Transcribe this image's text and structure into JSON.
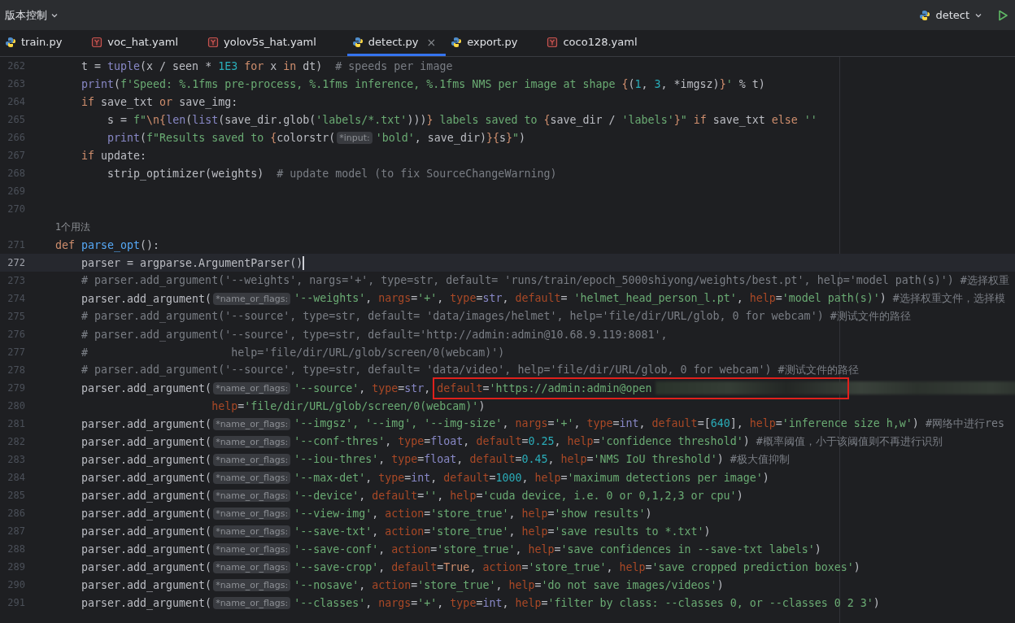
{
  "toolbar": {
    "vcs_label": "版本控制",
    "run_config": "detect"
  },
  "tabs": [
    {
      "label": "train.py",
      "kind": "python",
      "selected": false
    },
    {
      "label": "voc_hat.yaml",
      "kind": "yaml",
      "selected": false
    },
    {
      "label": "yolov5s_hat.yaml",
      "kind": "yaml",
      "selected": false
    },
    {
      "label": "detect.py",
      "kind": "python",
      "selected": true,
      "close": "×"
    },
    {
      "label": "export.py",
      "kind": "python",
      "selected": false
    },
    {
      "label": "coco128.yaml",
      "kind": "yaml",
      "selected": false
    }
  ],
  "editor": {
    "annotation": {
      "kind": "rectangle"
    },
    "lines": [
      {
        "number": "262",
        "current": false,
        "tokens": [
          {
            "kind": "plain",
            "text": "    t = "
          },
          {
            "kind": "builtin",
            "text": "tuple"
          },
          {
            "kind": "plain",
            "text": "(x / seen * "
          },
          {
            "kind": "num",
            "text": "1E3"
          },
          {
            "kind": "kw",
            "text": " for "
          },
          {
            "kind": "plain",
            "text": "x"
          },
          {
            "kind": "kw",
            "text": " in "
          },
          {
            "kind": "plain",
            "text": "dt)  "
          },
          {
            "kind": "cmt",
            "text": "# speeds per image"
          }
        ]
      },
      {
        "number": "263",
        "current": false,
        "tokens": [
          {
            "kind": "builtin",
            "text": "    print"
          },
          {
            "kind": "plain",
            "text": "("
          },
          {
            "kind": "str",
            "text": "f'Speed: %.1fms pre-process, %.1fms inference, %.1fms NMS per image at shape "
          },
          {
            "kind": "kw",
            "text": "{"
          },
          {
            "kind": "plain",
            "text": "("
          },
          {
            "kind": "num",
            "text": "1"
          },
          {
            "kind": "plain",
            "text": ", "
          },
          {
            "kind": "num",
            "text": "3"
          },
          {
            "kind": "plain",
            "text": ", *imgsz)"
          },
          {
            "kind": "kw",
            "text": "}"
          },
          {
            "kind": "str",
            "text": "'"
          },
          {
            "kind": "plain",
            "text": " % t)"
          }
        ]
      },
      {
        "number": "264",
        "current": false,
        "tokens": [
          {
            "kind": "kw",
            "text": "    if "
          },
          {
            "kind": "plain",
            "text": "save_txt "
          },
          {
            "kind": "kw",
            "text": "or "
          },
          {
            "kind": "plain",
            "text": "save_img:"
          }
        ]
      },
      {
        "number": "265",
        "current": false,
        "tokens": [
          {
            "kind": "plain",
            "text": "        s = "
          },
          {
            "kind": "str",
            "text": "f\""
          },
          {
            "kind": "kw",
            "text": "\\n{"
          },
          {
            "kind": "builtin",
            "text": "len"
          },
          {
            "kind": "plain",
            "text": "("
          },
          {
            "kind": "builtin",
            "text": "list"
          },
          {
            "kind": "plain",
            "text": "(save_dir.glob("
          },
          {
            "kind": "str",
            "text": "'labels/*.txt'"
          },
          {
            "kind": "plain",
            "text": ")))"
          },
          {
            "kind": "kw",
            "text": "}"
          },
          {
            "kind": "str",
            "text": " labels saved to "
          },
          {
            "kind": "kw",
            "text": "{"
          },
          {
            "kind": "plain",
            "text": "save_dir / "
          },
          {
            "kind": "str",
            "text": "'labels'"
          },
          {
            "kind": "kw",
            "text": "}"
          },
          {
            "kind": "str",
            "text": "\""
          },
          {
            "kind": "kw",
            "text": " if "
          },
          {
            "kind": "plain",
            "text": "save_txt "
          },
          {
            "kind": "kw",
            "text": "else "
          },
          {
            "kind": "str",
            "text": "''"
          }
        ]
      },
      {
        "number": "266",
        "current": false,
        "tokens": [
          {
            "kind": "builtin",
            "text": "        print"
          },
          {
            "kind": "plain",
            "text": "("
          },
          {
            "kind": "str",
            "text": "f\"Results saved to "
          },
          {
            "kind": "kw",
            "text": "{"
          },
          {
            "kind": "plain",
            "text": "colorstr("
          },
          {
            "kind": "hint",
            "text": "*input:"
          },
          {
            "kind": "str",
            "text": "'bold'"
          },
          {
            "kind": "plain",
            "text": ", save_dir)"
          },
          {
            "kind": "kw",
            "text": "}{"
          },
          {
            "kind": "plain",
            "text": "s"
          },
          {
            "kind": "kw",
            "text": "}"
          },
          {
            "kind": "str",
            "text": "\""
          },
          {
            "kind": "plain",
            "text": ")"
          }
        ]
      },
      {
        "number": "267",
        "current": false,
        "tokens": [
          {
            "kind": "kw",
            "text": "    if "
          },
          {
            "kind": "plain",
            "text": "update:"
          }
        ]
      },
      {
        "number": "268",
        "current": false,
        "tokens": [
          {
            "kind": "plain",
            "text": "        strip_optimizer(weights)  "
          },
          {
            "kind": "cmt",
            "text": "# update model (to fix SourceChangeWarning)"
          }
        ]
      },
      {
        "number": "269",
        "current": false
      },
      {
        "number": "270",
        "current": false
      },
      {
        "usage": "1个用法"
      },
      {
        "number": "271",
        "current": false,
        "tokens": [
          {
            "kind": "kw",
            "text": "def "
          },
          {
            "kind": "fn",
            "text": "parse_opt"
          },
          {
            "kind": "plain",
            "text": "():"
          }
        ]
      },
      {
        "number": "272",
        "current": true,
        "tokens": [
          {
            "kind": "plain",
            "text": "    parser = argparse.ArgumentParser()"
          }
        ]
      },
      {
        "number": "273",
        "current": false,
        "tokens": [
          {
            "kind": "cmt",
            "text": "    # parser.add_argument('--weights', nargs='+', type=str, default= 'runs/train/epoch_5000shiyong/weights/best.pt', help='model path(s)') #选择权重"
          }
        ]
      },
      {
        "number": "274",
        "current": false,
        "tokens": [
          {
            "kind": "plain",
            "text": "    parser.add_argument("
          },
          {
            "kind": "hint",
            "text": "*name_or_flags:"
          },
          {
            "kind": "str",
            "text": "'--weights'"
          },
          {
            "kind": "plain",
            "text": ", "
          },
          {
            "kind": "arg",
            "text": "nargs"
          },
          {
            "kind": "plain",
            "text": "="
          },
          {
            "kind": "str",
            "text": "'+'"
          },
          {
            "kind": "plain",
            "text": ", "
          },
          {
            "kind": "arg",
            "text": "type"
          },
          {
            "kind": "plain",
            "text": "="
          },
          {
            "kind": "builtin",
            "text": "str"
          },
          {
            "kind": "plain",
            "text": ", "
          },
          {
            "kind": "arg",
            "text": "default"
          },
          {
            "kind": "plain",
            "text": "= "
          },
          {
            "kind": "str",
            "text": "'helmet_head_person_l.pt'"
          },
          {
            "kind": "plain",
            "text": ", "
          },
          {
            "kind": "arg",
            "text": "help"
          },
          {
            "kind": "plain",
            "text": "="
          },
          {
            "kind": "str",
            "text": "'model path(s)'"
          },
          {
            "kind": "plain",
            "text": ") "
          },
          {
            "kind": "cmt",
            "text": "#选择权重文件，选择模"
          }
        ]
      },
      {
        "number": "275",
        "current": false,
        "tokens": [
          {
            "kind": "cmt",
            "text": "    # parser.add_argument('--source', type=str, default= 'data/images/helmet', help='file/dir/URL/glob, 0 for webcam') #测试文件的路径"
          }
        ]
      },
      {
        "number": "276",
        "current": false,
        "tokens": [
          {
            "kind": "cmt",
            "text": "    # parser.add_argument('--source', type=str, default='http://admin:admin@10.68.9.119:8081',"
          }
        ]
      },
      {
        "number": "277",
        "current": false,
        "tokens": [
          {
            "kind": "cmt",
            "text": "    #                      help='file/dir/URL/glob/screen/0(webcam)')"
          }
        ]
      },
      {
        "number": "278",
        "current": false,
        "tokens": [
          {
            "kind": "cmt",
            "text": "    # parser.add_argument('--source', type=str, default= 'data/video', help='file/dir/URL/glob, 0 for webcam') #测试文件的路径"
          }
        ]
      },
      {
        "number": "279",
        "current": false,
        "tokens": [
          {
            "kind": "plain",
            "text": "    parser.add_argument("
          },
          {
            "kind": "hint",
            "text": "*name_or_flags:"
          },
          {
            "kind": "str",
            "text": "'--source'"
          },
          {
            "kind": "plain",
            "text": ", "
          },
          {
            "kind": "arg",
            "text": "type"
          },
          {
            "kind": "plain",
            "text": "="
          },
          {
            "kind": "builtin",
            "text": "str"
          },
          {
            "kind": "plain",
            "text": ", "
          },
          {
            "kind": "arg",
            "text": "default"
          },
          {
            "kind": "plain",
            "text": "="
          },
          {
            "kind": "str",
            "text": "'https://admin:admin@open"
          },
          {
            "kind": "redacted"
          }
        ]
      },
      {
        "number": "280",
        "current": false,
        "tokens": [
          {
            "kind": "arg",
            "text": "                        help"
          },
          {
            "kind": "plain",
            "text": "="
          },
          {
            "kind": "str",
            "text": "'file/dir/URL/glob/screen/0(webcam)'"
          },
          {
            "kind": "plain",
            "text": ")"
          }
        ]
      },
      {
        "number": "281",
        "current": false,
        "tokens": [
          {
            "kind": "plain",
            "text": "    parser.add_argument("
          },
          {
            "kind": "hint",
            "text": "*name_or_flags:"
          },
          {
            "kind": "str",
            "text": "'--imgsz', '--img', '--img-size'"
          },
          {
            "kind": "plain",
            "text": ", "
          },
          {
            "kind": "arg",
            "text": "nargs"
          },
          {
            "kind": "plain",
            "text": "="
          },
          {
            "kind": "str",
            "text": "'+'"
          },
          {
            "kind": "plain",
            "text": ", "
          },
          {
            "kind": "arg",
            "text": "type"
          },
          {
            "kind": "plain",
            "text": "="
          },
          {
            "kind": "builtin",
            "text": "int"
          },
          {
            "kind": "plain",
            "text": ", "
          },
          {
            "kind": "arg",
            "text": "default"
          },
          {
            "kind": "plain",
            "text": "=["
          },
          {
            "kind": "num",
            "text": "640"
          },
          {
            "kind": "plain",
            "text": "], "
          },
          {
            "kind": "arg",
            "text": "help"
          },
          {
            "kind": "plain",
            "text": "="
          },
          {
            "kind": "str",
            "text": "'inference size h,w'"
          },
          {
            "kind": "plain",
            "text": ") "
          },
          {
            "kind": "cmt",
            "text": "#网络中进行res"
          }
        ]
      },
      {
        "number": "282",
        "current": false,
        "tokens": [
          {
            "kind": "plain",
            "text": "    parser.add_argument("
          },
          {
            "kind": "hint",
            "text": "*name_or_flags:"
          },
          {
            "kind": "str",
            "text": "'--conf-thres'"
          },
          {
            "kind": "plain",
            "text": ", "
          },
          {
            "kind": "arg",
            "text": "type"
          },
          {
            "kind": "plain",
            "text": "="
          },
          {
            "kind": "builtin",
            "text": "float"
          },
          {
            "kind": "plain",
            "text": ", "
          },
          {
            "kind": "arg",
            "text": "default"
          },
          {
            "kind": "plain",
            "text": "="
          },
          {
            "kind": "num",
            "text": "0.25"
          },
          {
            "kind": "plain",
            "text": ", "
          },
          {
            "kind": "arg",
            "text": "help"
          },
          {
            "kind": "plain",
            "text": "="
          },
          {
            "kind": "str",
            "text": "'confidence threshold'"
          },
          {
            "kind": "plain",
            "text": ") "
          },
          {
            "kind": "cmt",
            "text": "#概率阈值，小于该阈值则不再进行识别"
          }
        ]
      },
      {
        "number": "283",
        "current": false,
        "tokens": [
          {
            "kind": "plain",
            "text": "    parser.add_argument("
          },
          {
            "kind": "hint",
            "text": "*name_or_flags:"
          },
          {
            "kind": "str",
            "text": "'--iou-thres'"
          },
          {
            "kind": "plain",
            "text": ", "
          },
          {
            "kind": "arg",
            "text": "type"
          },
          {
            "kind": "plain",
            "text": "="
          },
          {
            "kind": "builtin",
            "text": "float"
          },
          {
            "kind": "plain",
            "text": ", "
          },
          {
            "kind": "arg",
            "text": "default"
          },
          {
            "kind": "plain",
            "text": "="
          },
          {
            "kind": "num",
            "text": "0.45"
          },
          {
            "kind": "plain",
            "text": ", "
          },
          {
            "kind": "arg",
            "text": "help"
          },
          {
            "kind": "plain",
            "text": "="
          },
          {
            "kind": "str",
            "text": "'NMS IoU threshold'"
          },
          {
            "kind": "plain",
            "text": ") "
          },
          {
            "kind": "cmt",
            "text": "#极大值抑制"
          }
        ]
      },
      {
        "number": "284",
        "current": false,
        "tokens": [
          {
            "kind": "plain",
            "text": "    parser.add_argument("
          },
          {
            "kind": "hint",
            "text": "*name_or_flags:"
          },
          {
            "kind": "str",
            "text": "'--max-det'"
          },
          {
            "kind": "plain",
            "text": ", "
          },
          {
            "kind": "arg",
            "text": "type"
          },
          {
            "kind": "plain",
            "text": "="
          },
          {
            "kind": "builtin",
            "text": "int"
          },
          {
            "kind": "plain",
            "text": ", "
          },
          {
            "kind": "arg",
            "text": "default"
          },
          {
            "kind": "plain",
            "text": "="
          },
          {
            "kind": "num",
            "text": "1000"
          },
          {
            "kind": "plain",
            "text": ", "
          },
          {
            "kind": "arg",
            "text": "help"
          },
          {
            "kind": "plain",
            "text": "="
          },
          {
            "kind": "str",
            "text": "'maximum detections per image'"
          },
          {
            "kind": "plain",
            "text": ")"
          }
        ]
      },
      {
        "number": "285",
        "current": false,
        "tokens": [
          {
            "kind": "plain",
            "text": "    parser.add_argument("
          },
          {
            "kind": "hint",
            "text": "*name_or_flags:"
          },
          {
            "kind": "str",
            "text": "'--device'"
          },
          {
            "kind": "plain",
            "text": ", "
          },
          {
            "kind": "arg",
            "text": "default"
          },
          {
            "kind": "plain",
            "text": "="
          },
          {
            "kind": "str",
            "text": "''"
          },
          {
            "kind": "plain",
            "text": ", "
          },
          {
            "kind": "arg",
            "text": "help"
          },
          {
            "kind": "plain",
            "text": "="
          },
          {
            "kind": "str",
            "text": "'cuda device, i.e. 0 or 0,1,2,3 or cpu'"
          },
          {
            "kind": "plain",
            "text": ")"
          }
        ]
      },
      {
        "number": "286",
        "current": false,
        "tokens": [
          {
            "kind": "plain",
            "text": "    parser.add_argument("
          },
          {
            "kind": "hint",
            "text": "*name_or_flags:"
          },
          {
            "kind": "str",
            "text": "'--view-img'"
          },
          {
            "kind": "plain",
            "text": ", "
          },
          {
            "kind": "arg",
            "text": "action"
          },
          {
            "kind": "plain",
            "text": "="
          },
          {
            "kind": "str",
            "text": "'store_true'"
          },
          {
            "kind": "plain",
            "text": ", "
          },
          {
            "kind": "arg",
            "text": "help"
          },
          {
            "kind": "plain",
            "text": "="
          },
          {
            "kind": "str",
            "text": "'show results'"
          },
          {
            "kind": "plain",
            "text": ")"
          }
        ]
      },
      {
        "number": "287",
        "current": false,
        "tokens": [
          {
            "kind": "plain",
            "text": "    parser.add_argument("
          },
          {
            "kind": "hint",
            "text": "*name_or_flags:"
          },
          {
            "kind": "str",
            "text": "'--save-txt'"
          },
          {
            "kind": "plain",
            "text": ", "
          },
          {
            "kind": "arg",
            "text": "action"
          },
          {
            "kind": "plain",
            "text": "="
          },
          {
            "kind": "str",
            "text": "'store_true'"
          },
          {
            "kind": "plain",
            "text": ", "
          },
          {
            "kind": "arg",
            "text": "help"
          },
          {
            "kind": "plain",
            "text": "="
          },
          {
            "kind": "str",
            "text": "'save results to *.txt'"
          },
          {
            "kind": "plain",
            "text": ")"
          }
        ]
      },
      {
        "number": "288",
        "current": false,
        "tokens": [
          {
            "kind": "plain",
            "text": "    parser.add_argument("
          },
          {
            "kind": "hint",
            "text": "*name_or_flags:"
          },
          {
            "kind": "str",
            "text": "'--save-conf'"
          },
          {
            "kind": "plain",
            "text": ", "
          },
          {
            "kind": "arg",
            "text": "action"
          },
          {
            "kind": "plain",
            "text": "="
          },
          {
            "kind": "str",
            "text": "'store_true'"
          },
          {
            "kind": "plain",
            "text": ", "
          },
          {
            "kind": "arg",
            "text": "help"
          },
          {
            "kind": "plain",
            "text": "="
          },
          {
            "kind": "str",
            "text": "'save confidences in --save-txt labels'"
          },
          {
            "kind": "plain",
            "text": ")"
          }
        ]
      },
      {
        "number": "289",
        "current": false,
        "tokens": [
          {
            "kind": "plain",
            "text": "    parser.add_argument("
          },
          {
            "kind": "hint",
            "text": "*name_or_flags:"
          },
          {
            "kind": "str",
            "text": "'--save-crop'"
          },
          {
            "kind": "plain",
            "text": ", "
          },
          {
            "kind": "arg",
            "text": "default"
          },
          {
            "kind": "plain",
            "text": "="
          },
          {
            "kind": "kw",
            "text": "True"
          },
          {
            "kind": "plain",
            "text": ", "
          },
          {
            "kind": "arg",
            "text": "action"
          },
          {
            "kind": "plain",
            "text": "="
          },
          {
            "kind": "str",
            "text": "'store_true'"
          },
          {
            "kind": "plain",
            "text": ", "
          },
          {
            "kind": "arg",
            "text": "help"
          },
          {
            "kind": "plain",
            "text": "="
          },
          {
            "kind": "str",
            "text": "'save cropped prediction boxes'"
          },
          {
            "kind": "plain",
            "text": ")"
          }
        ]
      },
      {
        "number": "290",
        "current": false,
        "tokens": [
          {
            "kind": "plain",
            "text": "    parser.add_argument("
          },
          {
            "kind": "hint",
            "text": "*name_or_flags:"
          },
          {
            "kind": "str",
            "text": "'--nosave'"
          },
          {
            "kind": "plain",
            "text": ", "
          },
          {
            "kind": "arg",
            "text": "action"
          },
          {
            "kind": "plain",
            "text": "="
          },
          {
            "kind": "str",
            "text": "'store_true'"
          },
          {
            "kind": "plain",
            "text": ", "
          },
          {
            "kind": "arg",
            "text": "help"
          },
          {
            "kind": "plain",
            "text": "="
          },
          {
            "kind": "str",
            "text": "'do not save images/videos'"
          },
          {
            "kind": "plain",
            "text": ")"
          }
        ]
      },
      {
        "number": "291",
        "current": false,
        "tokens": [
          {
            "kind": "plain",
            "text": "    parser.add_argument("
          },
          {
            "kind": "hint",
            "text": "*name_or_flags:"
          },
          {
            "kind": "str",
            "text": "'--classes'"
          },
          {
            "kind": "plain",
            "text": ", "
          },
          {
            "kind": "arg",
            "text": "nargs"
          },
          {
            "kind": "plain",
            "text": "="
          },
          {
            "kind": "str",
            "text": "'+'"
          },
          {
            "kind": "plain",
            "text": ", "
          },
          {
            "kind": "arg",
            "text": "type"
          },
          {
            "kind": "plain",
            "text": "="
          },
          {
            "kind": "builtin",
            "text": "int"
          },
          {
            "kind": "plain",
            "text": ", "
          },
          {
            "kind": "arg",
            "text": "help"
          },
          {
            "kind": "plain",
            "text": "="
          },
          {
            "kind": "str",
            "text": "'filter by class: --classes 0, or --classes 0 2 3'"
          },
          {
            "kind": "plain",
            "text": ")"
          }
        ]
      }
    ]
  }
}
